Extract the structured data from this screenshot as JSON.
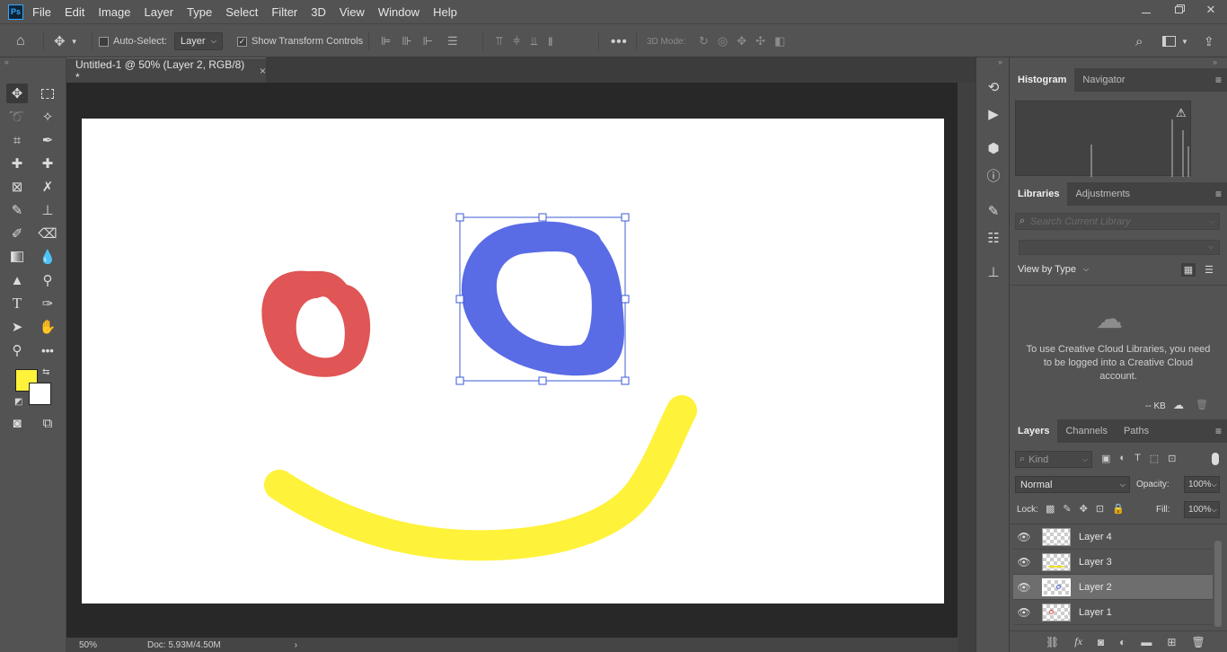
{
  "menubar": {
    "logo": "Ps",
    "items": [
      "File",
      "Edit",
      "Image",
      "Layer",
      "Type",
      "Select",
      "Filter",
      "3D",
      "View",
      "Window",
      "Help"
    ]
  },
  "options": {
    "auto_select_label": "Auto-Select:",
    "auto_select_value": "Layer",
    "transform_controls_label": "Show Transform Controls",
    "mode_3d_label": "3D Mode:"
  },
  "document": {
    "tab_title": "Untitled-1 @ 50% (Layer 2, RGB/8) *",
    "close": "×",
    "zoom": "50%",
    "doc_size": "Doc: 5.93M/4.50M",
    "shapes": {
      "red_circle": "#e05555",
      "blue_circle": "#5a6be6",
      "yellow_smile": "#fff23a"
    }
  },
  "colors": {
    "foreground": "#fff23a",
    "background": "#ffffff",
    "selection_accent": "#3b5bd6"
  },
  "histogram": {
    "tabs": [
      "Histogram",
      "Navigator"
    ],
    "warning_icon": "warning-icon"
  },
  "libraries": {
    "tabs": [
      "Libraries",
      "Adjustments"
    ],
    "search_placeholder": "Search Current Library",
    "view_by": "View by Type",
    "message": "To use Creative Cloud Libraries, you need to be logged into a Creative Cloud account.",
    "size": "-- KB"
  },
  "layers_panel": {
    "tabs": [
      "Layers",
      "Channels",
      "Paths"
    ],
    "kind_placeholder": "Kind",
    "blend_mode": "Normal",
    "opacity_label": "Opacity:",
    "opacity_value": "100%",
    "lock_label": "Lock:",
    "fill_label": "Fill:",
    "fill_value": "100%",
    "layers": [
      {
        "name": "Layer 4",
        "selected": false
      },
      {
        "name": "Layer 3",
        "selected": false
      },
      {
        "name": "Layer 2",
        "selected": true
      },
      {
        "name": "Layer 1",
        "selected": false
      }
    ],
    "footer_fx": "fx"
  }
}
